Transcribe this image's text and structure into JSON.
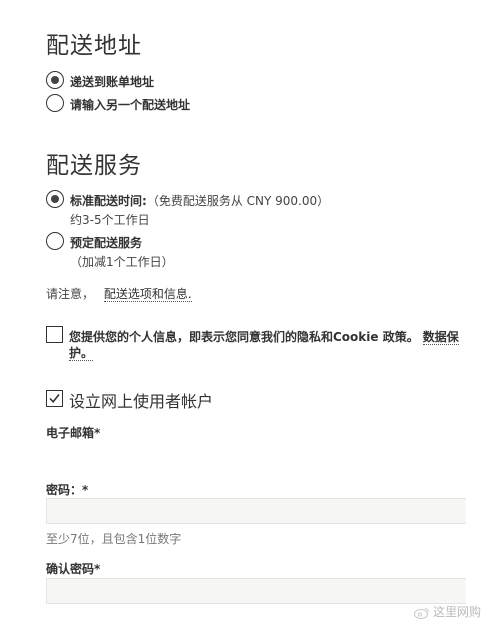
{
  "shipping_address": {
    "heading": "配送地址",
    "options": [
      {
        "label": "递送到账单地址",
        "checked": true
      },
      {
        "label": "请输入另一个配送地址",
        "checked": false
      }
    ]
  },
  "shipping_service": {
    "heading": "配送服务",
    "standard_label": "标准配送时间:",
    "standard_note": "（免费配送服务从 CNY 900.00）",
    "standard_days": "约3-5个工作日",
    "scheduled_label": "预定配送服务",
    "scheduled_note": "（加减1个工作日）",
    "notice_prefix": "请注意，",
    "notice_link": "配送选项和信息."
  },
  "privacy": {
    "text_line1": "您提供您的个人信息，即表示您同意我们的隐私和Cookie 政策。",
    "link_part1": "数据保",
    "link_part2": "护。",
    "checked": false
  },
  "account": {
    "label": "设立网上使用者帐户",
    "checked": true,
    "email_label": "电子邮箱*",
    "password_label": "密码：*",
    "password_hint": "至少7位，且包含1位数字",
    "confirm_label": "确认密码*"
  },
  "watermark": "这里网购"
}
